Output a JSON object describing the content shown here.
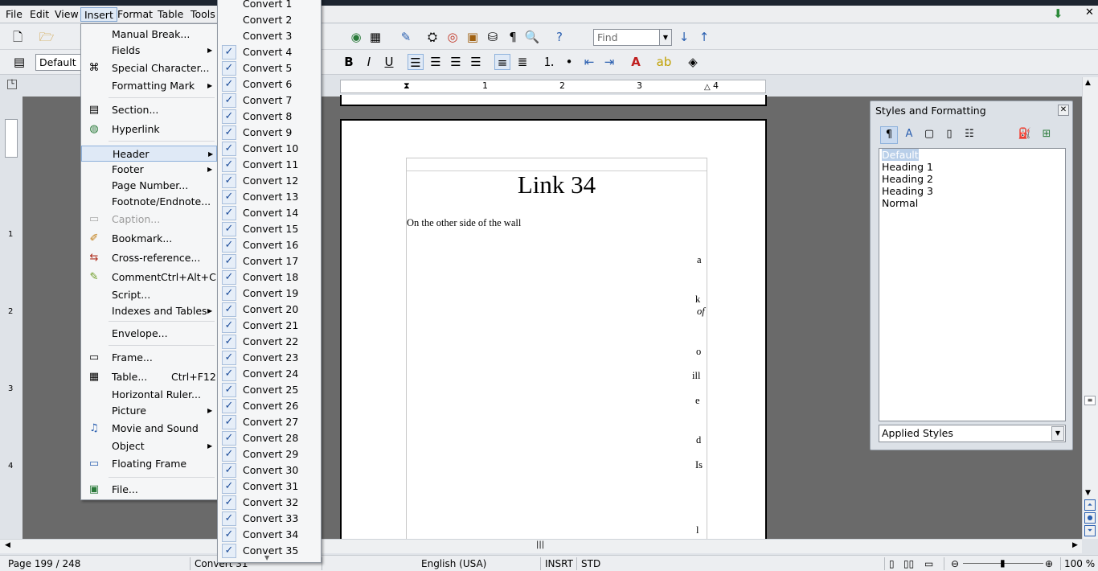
{
  "menubar": {
    "items": [
      {
        "label": "File"
      },
      {
        "label": "Edit"
      },
      {
        "label": "View"
      },
      {
        "label": "Insert"
      },
      {
        "label": "Format"
      },
      {
        "label": "Table"
      },
      {
        "label": "Tools"
      }
    ]
  },
  "toolbar": {
    "find_placeholder": "Find",
    "paragraph_style": "Default"
  },
  "insert_menu": {
    "items": [
      {
        "label": "Manual Break...",
        "icon": ""
      },
      {
        "label": "Fields",
        "icon": "",
        "submenu": true
      },
      {
        "label": "Special Character...",
        "icon": "special-char-icon"
      },
      {
        "label": "Formatting Mark",
        "icon": "",
        "submenu": true
      },
      {
        "label": "Section...",
        "icon": "section-icon"
      },
      {
        "label": "Hyperlink",
        "icon": "hyperlink-icon"
      },
      {
        "label": "Header",
        "icon": "",
        "submenu": true
      },
      {
        "label": "Footer",
        "icon": "",
        "submenu": true
      },
      {
        "label": "Page Number...",
        "icon": ""
      },
      {
        "label": "Footnote/Endnote...",
        "icon": ""
      },
      {
        "label": "Caption...",
        "icon": "caption-icon",
        "disabled": true
      },
      {
        "label": "Bookmark...",
        "icon": "bookmark-icon"
      },
      {
        "label": "Cross-reference...",
        "icon": "cross-reference-icon"
      },
      {
        "label": "Comment",
        "icon": "comment-icon",
        "shortcut": "Ctrl+Alt+C"
      },
      {
        "label": "Script...",
        "icon": ""
      },
      {
        "label": "Indexes and Tables",
        "icon": "",
        "submenu": true
      },
      {
        "label": "Envelope...",
        "icon": ""
      },
      {
        "label": "Frame...",
        "icon": "frame-icon"
      },
      {
        "label": "Table...",
        "icon": "table-icon",
        "shortcut": "Ctrl+F12"
      },
      {
        "label": "Horizontal Ruler...",
        "icon": ""
      },
      {
        "label": "Picture",
        "icon": "",
        "submenu": true
      },
      {
        "label": "Movie and Sound",
        "icon": "movie-icon"
      },
      {
        "label": "Object",
        "icon": "",
        "submenu": true
      },
      {
        "label": "Floating Frame",
        "icon": "floating-frame-icon"
      },
      {
        "label": "File...",
        "icon": "file-icon"
      }
    ]
  },
  "header_submenu": {
    "items": [
      {
        "label": "Convert 1"
      },
      {
        "label": "Convert 2"
      },
      {
        "label": "Convert 3"
      },
      {
        "label": "Convert 4"
      },
      {
        "label": "Convert 5"
      },
      {
        "label": "Convert 6"
      },
      {
        "label": "Convert 7"
      },
      {
        "label": "Convert 8"
      },
      {
        "label": "Convert 9"
      },
      {
        "label": "Convert 10"
      },
      {
        "label": "Convert 11"
      },
      {
        "label": "Convert 12"
      },
      {
        "label": "Convert 13"
      },
      {
        "label": "Convert 14"
      },
      {
        "label": "Convert 15"
      },
      {
        "label": "Convert 16"
      },
      {
        "label": "Convert 17"
      },
      {
        "label": "Convert 18"
      },
      {
        "label": "Convert 19"
      },
      {
        "label": "Convert 20"
      },
      {
        "label": "Convert 21"
      },
      {
        "label": "Convert 22"
      },
      {
        "label": "Convert 23"
      },
      {
        "label": "Convert 24"
      },
      {
        "label": "Convert 25"
      },
      {
        "label": "Convert 26"
      },
      {
        "label": "Convert 27"
      },
      {
        "label": "Convert 28"
      },
      {
        "label": "Convert 29"
      },
      {
        "label": "Convert 30"
      },
      {
        "label": "Convert 31"
      },
      {
        "label": "Convert 32"
      },
      {
        "label": "Convert 33"
      },
      {
        "label": "Convert 34"
      },
      {
        "label": "Convert 35"
      }
    ]
  },
  "document": {
    "title": "Link 34",
    "first_line": "On the other side of the wall",
    "fragments": [
      "a",
      "k",
      "of",
      "o",
      "ill",
      "e",
      "d",
      "Is",
      "l"
    ]
  },
  "ruler": {
    "h_numbers": [
      "1",
      "2",
      "3",
      "4"
    ],
    "v_numbers": [
      "1",
      "2",
      "3",
      "4"
    ]
  },
  "styles_panel": {
    "title": "Styles and Formatting",
    "styles": [
      "Default",
      "Heading 1",
      "Heading 2",
      "Heading 3",
      "Normal"
    ],
    "selected": "Default",
    "filter": "Applied Styles"
  },
  "statusbar": {
    "page": "Page 199 / 248",
    "page_style": "Convert 31",
    "language": "English (USA)",
    "insert_mode": "INSRT",
    "selection_mode": "STD",
    "zoom": "100 %"
  },
  "colors": {
    "menu_bg": "#f5f6f7",
    "highlight": "#dfe9f6",
    "workspace": "#6a6a6a",
    "check": "#1f4e9a"
  }
}
